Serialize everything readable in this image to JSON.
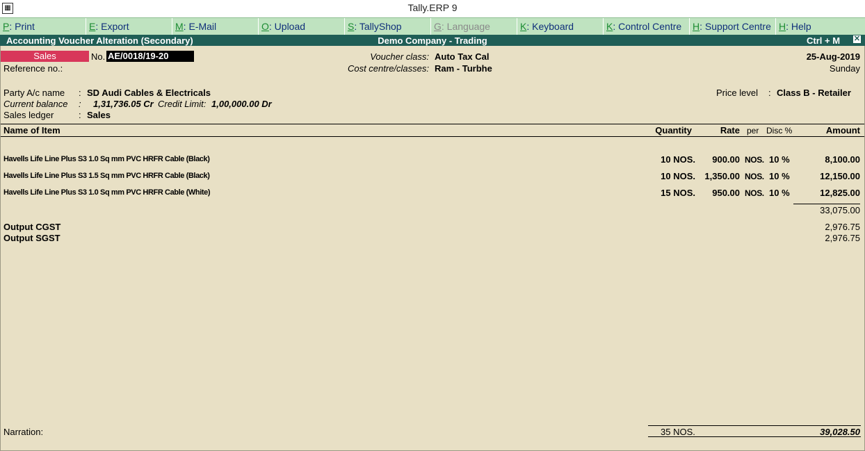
{
  "window": {
    "title": "Tally.ERP 9"
  },
  "buttons": [
    {
      "key": "P",
      "label": ": Print",
      "disabled": false
    },
    {
      "key": "E",
      "label": ": Export",
      "disabled": false
    },
    {
      "key": "M",
      "label": ": E-Mail",
      "disabled": false
    },
    {
      "key": "O",
      "label": ": Upload",
      "disabled": false
    },
    {
      "key": "S",
      "label": ": TallyShop",
      "disabled": false
    },
    {
      "key": "G",
      "label": ": Language",
      "disabled": true
    },
    {
      "key": "K",
      "label": ": Keyboard",
      "disabled": false
    },
    {
      "key": "K",
      "label": ": Control Centre",
      "disabled": false
    },
    {
      "key": "H",
      "label": ": Support Centre",
      "disabled": false
    },
    {
      "key": "H",
      "label": ": Help",
      "disabled": false
    }
  ],
  "header": {
    "left": "Accounting Voucher  Alteration  (Secondary)",
    "center": "Demo Company - Trading",
    "shortcut": "Ctrl + M",
    "close": "✕"
  },
  "voucher": {
    "type": "Sales",
    "no_label": "No.",
    "no_value": "AE/0018/19-20",
    "reference_label": "Reference no.:",
    "class_label": "Voucher class:",
    "class_value": "Auto Tax Cal",
    "cost_label": "Cost centre/classes:",
    "cost_value": "Ram - Turbhe",
    "date": "25-Aug-2019",
    "day": "Sunday"
  },
  "party": {
    "label": "Party A/c name",
    "value": "SD Audi Cables & Electricals",
    "balance_label": "Current balance",
    "balance_value": "1,31,736.05 Cr",
    "credit_label": "Credit Limit:",
    "credit_value": "1,00,000.00 Dr",
    "ledger_label": "Sales ledger",
    "ledger_value": "Sales",
    "price_level_label": "Price level",
    "price_level_value": "Class B - Retailer",
    "colon": ":"
  },
  "columns": {
    "name": "Name of Item",
    "quantity": "Quantity",
    "rate": "Rate",
    "per": "per",
    "disc": "Disc %",
    "amount": "Amount"
  },
  "items": [
    {
      "name": "Havells Life Line Plus S3 1.0 Sq mm PVC HRFR Cable (Black)",
      "qty": "10 NOS.",
      "rate": "900.00",
      "per": "NOS.",
      "disc": "10 %",
      "amount": "8,100.00"
    },
    {
      "name": "Havells Life Line Plus S3 1.5 Sq mm PVC HRFR Cable (Black)",
      "qty": "10 NOS.",
      "rate": "1,350.00",
      "per": "NOS.",
      "disc": "10 %",
      "amount": "12,150.00"
    },
    {
      "name": "Havells Life Line Plus S3 1.0 Sq mm PVC HRFR Cable (White)",
      "qty": "15 NOS.",
      "rate": "950.00",
      "per": "NOS.",
      "disc": "10 %",
      "amount": "12,825.00"
    }
  ],
  "subtotal": "33,075.00",
  "taxes": [
    {
      "name": "Output CGST",
      "amount": "2,976.75"
    },
    {
      "name": "Output SGST",
      "amount": "2,976.75"
    }
  ],
  "footer": {
    "narration_label": "Narration:",
    "total_qty": "35 NOS.",
    "total_amount": "39,028.50"
  },
  "colors": {
    "header_bg": "#1f5e56",
    "button_bar": "#bfe3c0",
    "voucher_type_bg": "#d8375a",
    "main_bg": "#e8e0c5"
  }
}
